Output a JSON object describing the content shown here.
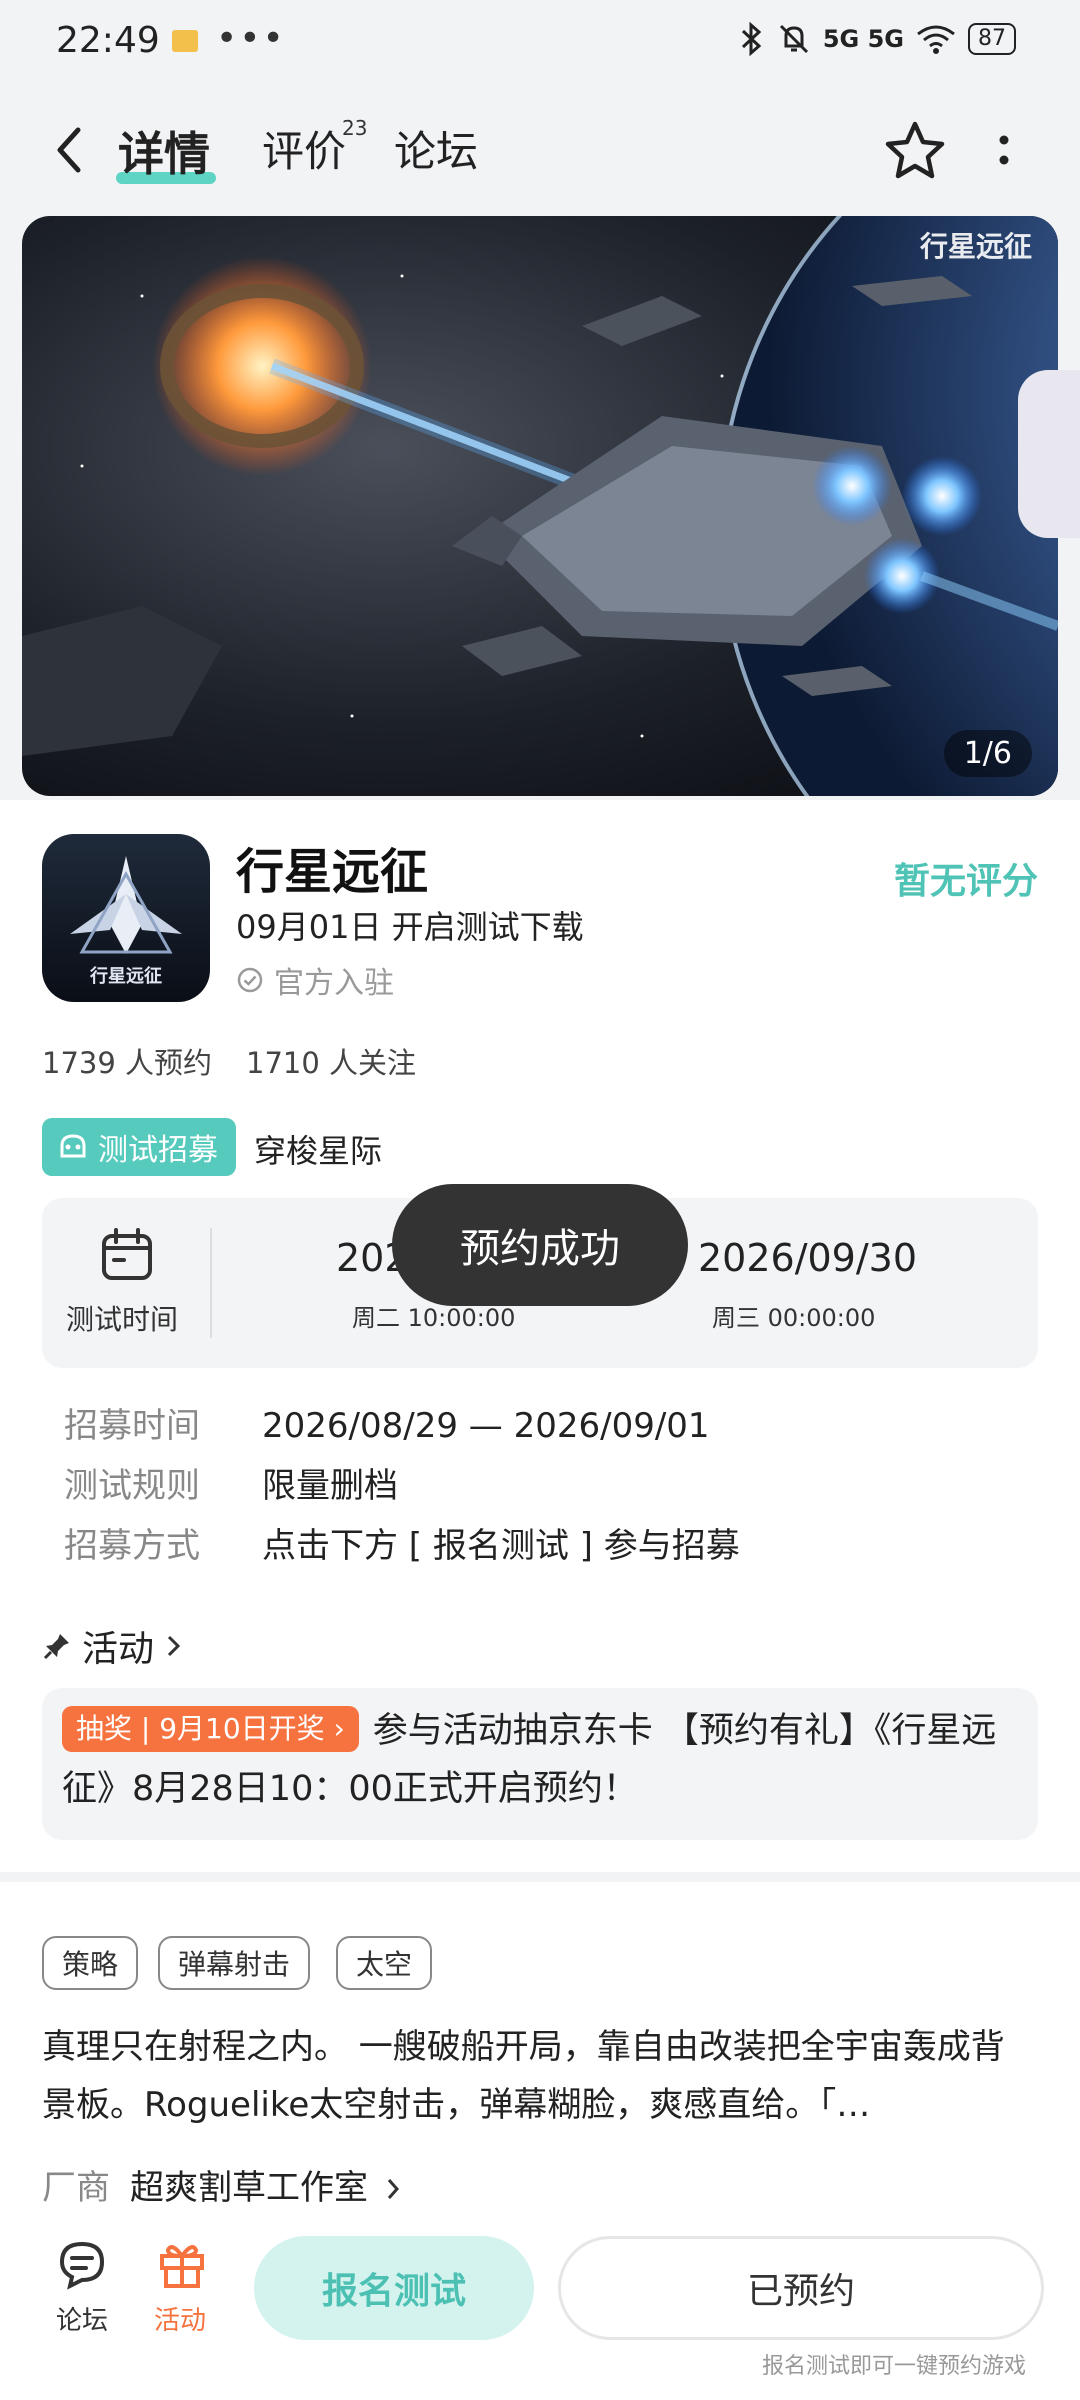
{
  "status_bar": {
    "time": "22:49",
    "dots": "•••",
    "signals": "5G 5G",
    "battery": "87",
    "icons": [
      "bluetooth-icon",
      "mute-icon",
      "signal-icon",
      "wifi-icon",
      "battery-icon"
    ]
  },
  "nav": {
    "tabs": [
      {
        "label": "详情",
        "active": true
      },
      {
        "label": "评价",
        "badge": "23"
      },
      {
        "label": "论坛"
      }
    ]
  },
  "banner": {
    "counter": "1/6",
    "logo_text": "行星远征"
  },
  "app": {
    "icon_text": "行星远征",
    "title": "行星远征",
    "subtitle": "09月01日 开启测试下载",
    "official": "官方入驻",
    "rating": "暂无评分",
    "reservations": "1739 人预约",
    "followers": "1710 人关注"
  },
  "recruit": {
    "tag": "测试招募",
    "name": "穿梭星际",
    "time_label": "测试时间",
    "start_date": "2026/09/01",
    "start_weekday": "周二  10:00:00",
    "end_date": "2026/09/30",
    "end_weekday": "周三  00:00:00",
    "toast": "预约成功",
    "details": [
      {
        "key": "招募时间",
        "value": "2026/08/29 — 2026/09/01"
      },
      {
        "key": "测试规则",
        "value": "限量删档"
      },
      {
        "key": "招募方式",
        "value": "点击下方 [ 报名测试 ] 参与招募"
      }
    ]
  },
  "activity": {
    "heading": "活动",
    "tag": "抽奖 | 9月10日开奖 ›",
    "text": "参与活动抽京东卡 【预约有礼】《行星远征》8月28日10：00正式开启预约！"
  },
  "tags": [
    "策略",
    "弹幕射击",
    "太空"
  ],
  "description": "真理只在射程之内。 一艘破船开局，靠自由改装把全宇宙轰成背景板。Roguelike太空射击，弹幕糊脸，爽感直给。「…",
  "vendor": {
    "key": "厂商",
    "value": "超爽割草工作室"
  },
  "bottom": {
    "forum_label": "论坛",
    "activity_label": "活动",
    "signup": "报名测试",
    "reserved": "已预约",
    "hint": "报名测试即可一键预约游戏"
  },
  "colors": {
    "accent": "#4fc3b5",
    "accent_light": "#d4f3ef",
    "orange": "#f6733f"
  }
}
